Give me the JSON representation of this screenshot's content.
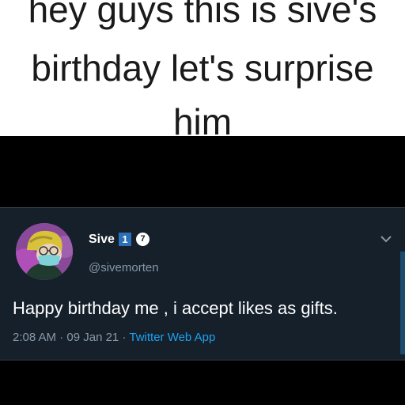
{
  "caption": {
    "line1": "hey guys this is sive's",
    "line2": "birthday let's surprise",
    "line3": "him"
  },
  "tweet": {
    "display_name": "Sive",
    "badge_number": "1",
    "badge_verified_glyph": "7",
    "handle": "@sivemorten",
    "text": "Happy birthday me , i accept likes as gifts.",
    "time": "2:08 AM",
    "date": "09 Jan 21",
    "source": "Twitter Web App",
    "separator": "·"
  },
  "icons": {
    "avatar": "avatar-cartoon-mask",
    "menu": "chevron-down-icon"
  },
  "colors": {
    "tweet_bg": "#15202b",
    "text_primary": "#ffffff",
    "text_secondary": "#8899a6",
    "link": "#1da1f2"
  }
}
